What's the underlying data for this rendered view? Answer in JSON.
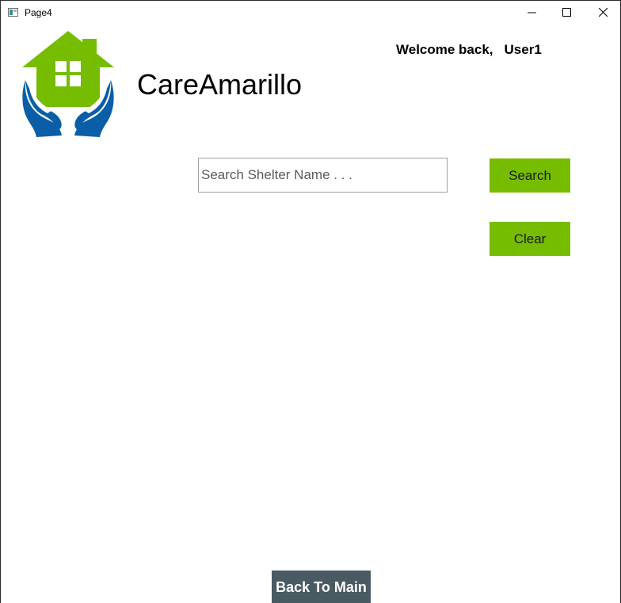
{
  "window": {
    "title": "Page4",
    "controls": [
      "minimize-icon",
      "maximize-icon",
      "close-icon"
    ]
  },
  "header": {
    "app_name": "CareAmarillo",
    "welcome_prefix": "Welcome back,",
    "username": "User1",
    "logo_icon": "house-in-hands-icon"
  },
  "search": {
    "placeholder": "Search Shelter Name . . .",
    "value": "",
    "search_label": "Search",
    "clear_label": "Clear"
  },
  "footer": {
    "back_label": "Back To Main"
  },
  "colors": {
    "accent_green": "#76bc00",
    "back_button_bg": "#4a5a63",
    "logo_blue": "#0a5ea8"
  }
}
